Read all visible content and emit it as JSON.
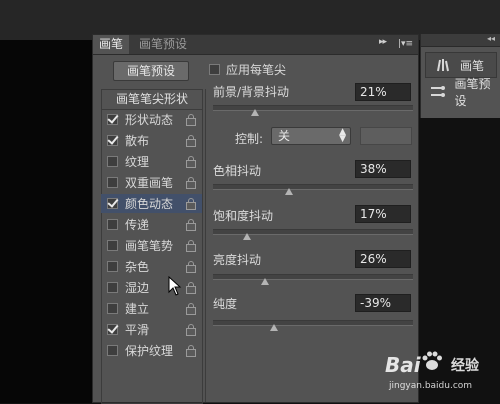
{
  "panel": {
    "tabs": {
      "active": "画笔",
      "inactive": "画笔预设"
    },
    "preset_button": "画笔预设",
    "tip_shape_header": "画笔笔尖形状",
    "apply_label": "应用每笔尖",
    "options": [
      {
        "label": "形状动态",
        "checked": true,
        "selected": false
      },
      {
        "label": "散布",
        "checked": true,
        "selected": false
      },
      {
        "label": "纹理",
        "checked": false,
        "selected": false
      },
      {
        "label": "双重画笔",
        "checked": false,
        "selected": false
      },
      {
        "label": "颜色动态",
        "checked": true,
        "selected": true
      },
      {
        "label": "传递",
        "checked": false,
        "selected": false
      },
      {
        "label": "画笔笔势",
        "checked": false,
        "selected": false
      },
      {
        "label": "杂色",
        "checked": false,
        "selected": false
      },
      {
        "label": "湿边",
        "checked": false,
        "selected": false
      },
      {
        "label": "建立",
        "checked": false,
        "selected": false
      },
      {
        "label": "平滑",
        "checked": true,
        "selected": false
      },
      {
        "label": "保护纹理",
        "checked": false,
        "selected": false
      }
    ],
    "params": {
      "fg_bg_jitter": {
        "label": "前景/背景抖动",
        "value": "21%",
        "slider": 0.21
      },
      "control": {
        "label": "控制:",
        "value": "关"
      },
      "hue_jitter": {
        "label": "色相抖动",
        "value": "38%",
        "slider": 0.38
      },
      "sat_jitter": {
        "label": "饱和度抖动",
        "value": "17%",
        "slider": 0.17
      },
      "bright_jitter": {
        "label": "亮度抖动",
        "value": "26%",
        "slider": 0.26
      },
      "purity": {
        "label": "纯度",
        "value": "-39%",
        "slider": 0.305
      }
    }
  },
  "mini_panel": {
    "items": [
      {
        "label": "画笔"
      },
      {
        "label": "画笔预设"
      }
    ]
  },
  "watermark": {
    "brand": "Bai",
    "suffix": "经验",
    "url": "jingyan.baidu.com"
  }
}
